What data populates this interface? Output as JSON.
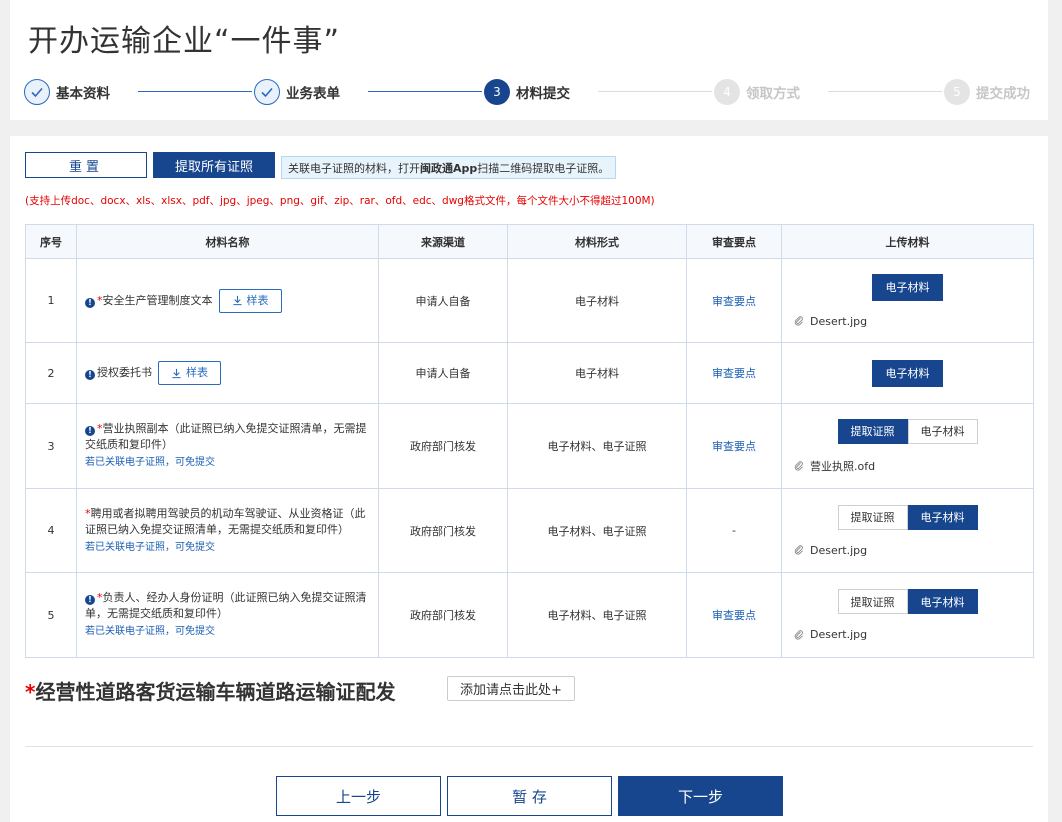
{
  "page_title": "开办运输企业“一件事”",
  "steps": [
    {
      "num": "1",
      "label": "基本资料",
      "state": "done"
    },
    {
      "num": "2",
      "label": "业务表单",
      "state": "done"
    },
    {
      "num": "3",
      "label": "材料提交",
      "state": "active"
    },
    {
      "num": "4",
      "label": "领取方式",
      "state": "todo"
    },
    {
      "num": "5",
      "label": "提交成功",
      "state": "todo"
    }
  ],
  "toolbar": {
    "reset_label": "重置",
    "fetch_all_label": "提取所有证照",
    "hint_prefix": "关联电子证照的材料，打开",
    "hint_app": "闽政通App",
    "hint_suffix": "扫描二维码提取电子证照。"
  },
  "upload_note": "(支持上传doc、docx、xls、xlsx、pdf、jpg、jpeg、png、gif、zip、rar、ofd、edc、dwg格式文件，每个文件大小不得超过100M)",
  "table": {
    "headers": {
      "index": "序号",
      "name": "材料名称",
      "source": "来源渠道",
      "form": "材料形式",
      "check": "审查要点",
      "upload": "上传材料"
    },
    "rows": [
      {
        "index": "1",
        "required": "*",
        "name": "安全生产管理制度文本",
        "sample": "样表",
        "source": "申请人自备",
        "form": "电子材料",
        "check": "审查要点",
        "upload_btn": "电子材料",
        "file": "Desert.jpg"
      },
      {
        "index": "2",
        "required": "",
        "name": "授权委托书",
        "sample": "样表",
        "source": "申请人自备",
        "form": "电子材料",
        "check": "审查要点",
        "upload_btn": "电子材料"
      },
      {
        "index": "3",
        "required": "*",
        "name": "营业执照副本（此证照已纳入免提交证照清单，无需提交纸质和复印件）",
        "sub_link": "若已关联电子证照，可免提交",
        "source": "政府部门核发",
        "form": "电子材料、电子证照",
        "check": "审查要点",
        "toggle_left": "提取证照",
        "toggle_right": "电子材料",
        "file": "营业执照.ofd"
      },
      {
        "index": "4",
        "required": "*",
        "name": "聘用或者拟聘用驾驶员的机动车驾驶证、从业资格证（此证照已纳入免提交证照清单，无需提交纸质和复印件）",
        "sub_link": "若已关联电子证照，可免提交",
        "source": "政府部门核发",
        "form": "电子材料、电子证照",
        "check": "-",
        "toggle_left": "提取证照",
        "toggle_right": "电子材料",
        "file": "Desert.jpg"
      },
      {
        "index": "5",
        "required": "*",
        "name": "负责人、经办人身份证明（此证照已纳入免提交证照清单，无需提交纸质和复印件）",
        "sub_link": "若已关联电子证照，可免提交",
        "source": "政府部门核发",
        "form": "电子材料、电子证照",
        "check": "审查要点",
        "toggle_left": "提取证照",
        "toggle_right": "电子材料",
        "file": "Desert.jpg"
      }
    ]
  },
  "section": {
    "required": "*",
    "title": "经营性道路客货运输车辆道路运输证配发",
    "add_label": "添加请点击此处+"
  },
  "footer": {
    "prev_label": "上一步",
    "save_label": "暂 存",
    "next_label": "下一步"
  },
  "colors": {
    "primary": "#17468f",
    "link": "#1c5fb5",
    "required": "#e60000"
  }
}
